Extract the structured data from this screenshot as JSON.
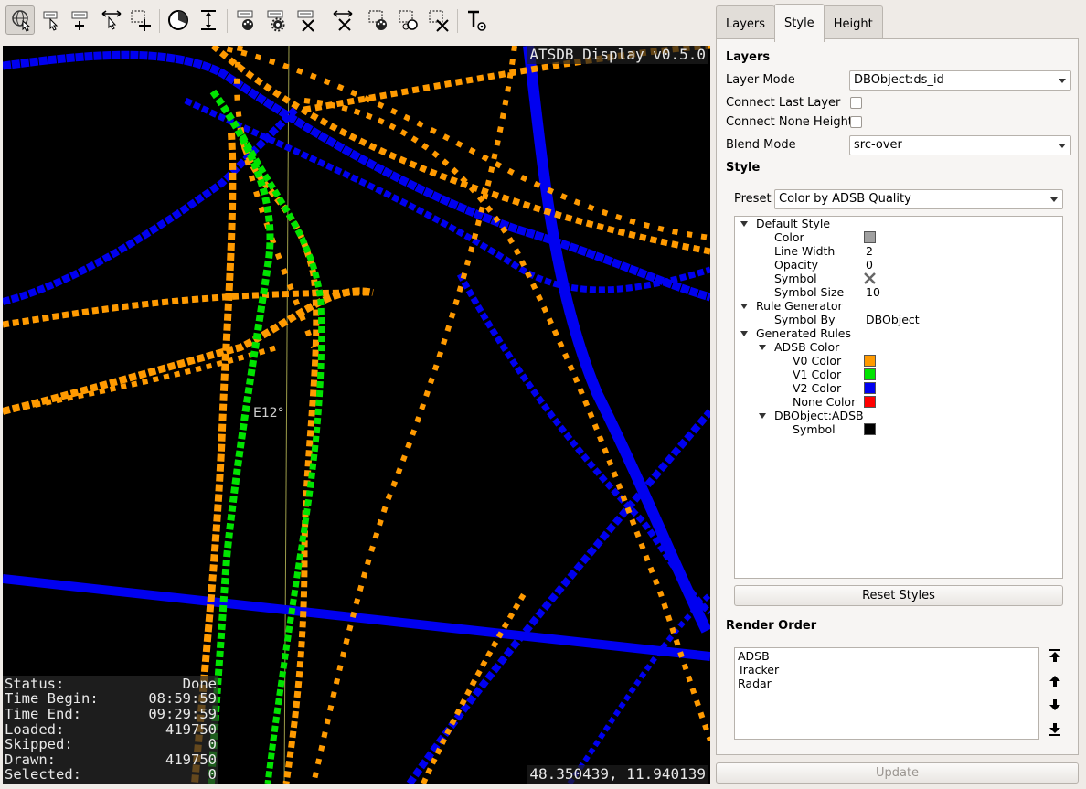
{
  "map": {
    "title": "ATSDB Display v0.5.0",
    "coordinates": "48.350439, 11.940139",
    "grid_label": "E12°",
    "status": [
      {
        "label": "Status:",
        "value": "Done"
      },
      {
        "label": "Time Begin:",
        "value": "08:59:59"
      },
      {
        "label": "Time End:",
        "value": "09:29:59"
      },
      {
        "label": "Loaded:",
        "value": "419750"
      },
      {
        "label": "Skipped:",
        "value": "0"
      },
      {
        "label": "Drawn:",
        "value": "419750"
      },
      {
        "label": "Selected:",
        "value": "0"
      }
    ]
  },
  "toolbar": {
    "icons": [
      "navigate-globe-icon",
      "select-list-icon",
      "add-list-icon",
      "select-arrow-icon",
      "add-select-rect-icon",
      "time-filter-icon",
      "height-filter-icon",
      "layer-style-list-icon",
      "layer-settings-list-icon",
      "layer-delete-list-icon",
      "delete-arrows-icon",
      "palette-select-icon",
      "select-ellipse-icon",
      "delete-select-icon",
      "text-tool-icon"
    ]
  },
  "panel": {
    "tabs": [
      "Layers",
      "Style",
      "Height"
    ],
    "selected_tab": "Style",
    "layers_heading": "Layers",
    "layer_mode_label": "Layer Mode",
    "layer_mode_value": "DBObject:ds_id",
    "connect_last_layer_label": "Connect Last Layer",
    "connect_none_height_label": "Connect None Height",
    "blend_mode_label": "Blend Mode",
    "blend_mode_value": "src-over",
    "style_heading": "Style",
    "preset_label": "Preset",
    "preset_value": "Color by ADSB Quality",
    "tree": {
      "default_style": "Default Style",
      "color_label": "Color",
      "line_width_label": "Line Width",
      "line_width_value": "2",
      "opacity_label": "Opacity",
      "opacity_value": "0",
      "symbol_label": "Symbol",
      "symbol_size_label": "Symbol Size",
      "symbol_size_value": "10",
      "rule_generator": "Rule Generator",
      "symbol_by_label": "Symbol By",
      "symbol_by_value": "DBObject",
      "generated_rules": "Generated Rules",
      "adsb_color": "ADSB Color",
      "v0_color": "V0 Color",
      "v1_color": "V1 Color",
      "v2_color": "V2 Color",
      "none_color": "None Color",
      "dbobject_adsb": "DBObject:ADSB",
      "symbol2_label": "Symbol"
    },
    "colors": {
      "default": "#a0a0a0",
      "v0": "#ff9a00",
      "v1": "#00e400",
      "v2": "#0000f0",
      "none": "#ff0000",
      "symbol": "#000000"
    },
    "reset_styles": "Reset Styles",
    "render_order_heading": "Render Order",
    "render_order": [
      "ADSB",
      "Tracker",
      "Radar"
    ],
    "update": "Update"
  }
}
